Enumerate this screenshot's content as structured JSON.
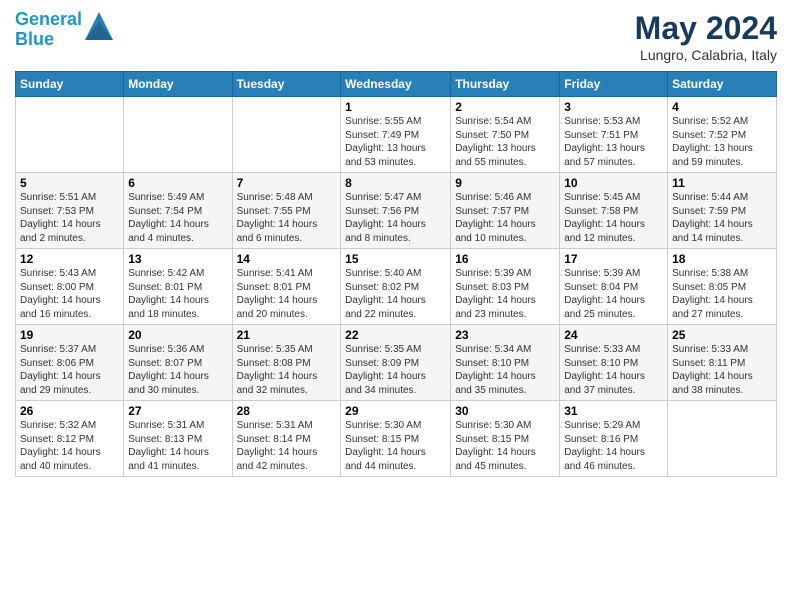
{
  "header": {
    "logo_line1": "General",
    "logo_line2": "Blue",
    "month": "May 2024",
    "location": "Lungro, Calabria, Italy"
  },
  "days_of_week": [
    "Sunday",
    "Monday",
    "Tuesday",
    "Wednesday",
    "Thursday",
    "Friday",
    "Saturday"
  ],
  "weeks": [
    [
      {
        "day": "",
        "info": ""
      },
      {
        "day": "",
        "info": ""
      },
      {
        "day": "",
        "info": ""
      },
      {
        "day": "1",
        "info": "Sunrise: 5:55 AM\nSunset: 7:49 PM\nDaylight: 13 hours\nand 53 minutes."
      },
      {
        "day": "2",
        "info": "Sunrise: 5:54 AM\nSunset: 7:50 PM\nDaylight: 13 hours\nand 55 minutes."
      },
      {
        "day": "3",
        "info": "Sunrise: 5:53 AM\nSunset: 7:51 PM\nDaylight: 13 hours\nand 57 minutes."
      },
      {
        "day": "4",
        "info": "Sunrise: 5:52 AM\nSunset: 7:52 PM\nDaylight: 13 hours\nand 59 minutes."
      }
    ],
    [
      {
        "day": "5",
        "info": "Sunrise: 5:51 AM\nSunset: 7:53 PM\nDaylight: 14 hours\nand 2 minutes."
      },
      {
        "day": "6",
        "info": "Sunrise: 5:49 AM\nSunset: 7:54 PM\nDaylight: 14 hours\nand 4 minutes."
      },
      {
        "day": "7",
        "info": "Sunrise: 5:48 AM\nSunset: 7:55 PM\nDaylight: 14 hours\nand 6 minutes."
      },
      {
        "day": "8",
        "info": "Sunrise: 5:47 AM\nSunset: 7:56 PM\nDaylight: 14 hours\nand 8 minutes."
      },
      {
        "day": "9",
        "info": "Sunrise: 5:46 AM\nSunset: 7:57 PM\nDaylight: 14 hours\nand 10 minutes."
      },
      {
        "day": "10",
        "info": "Sunrise: 5:45 AM\nSunset: 7:58 PM\nDaylight: 14 hours\nand 12 minutes."
      },
      {
        "day": "11",
        "info": "Sunrise: 5:44 AM\nSunset: 7:59 PM\nDaylight: 14 hours\nand 14 minutes."
      }
    ],
    [
      {
        "day": "12",
        "info": "Sunrise: 5:43 AM\nSunset: 8:00 PM\nDaylight: 14 hours\nand 16 minutes."
      },
      {
        "day": "13",
        "info": "Sunrise: 5:42 AM\nSunset: 8:01 PM\nDaylight: 14 hours\nand 18 minutes."
      },
      {
        "day": "14",
        "info": "Sunrise: 5:41 AM\nSunset: 8:01 PM\nDaylight: 14 hours\nand 20 minutes."
      },
      {
        "day": "15",
        "info": "Sunrise: 5:40 AM\nSunset: 8:02 PM\nDaylight: 14 hours\nand 22 minutes."
      },
      {
        "day": "16",
        "info": "Sunrise: 5:39 AM\nSunset: 8:03 PM\nDaylight: 14 hours\nand 23 minutes."
      },
      {
        "day": "17",
        "info": "Sunrise: 5:39 AM\nSunset: 8:04 PM\nDaylight: 14 hours\nand 25 minutes."
      },
      {
        "day": "18",
        "info": "Sunrise: 5:38 AM\nSunset: 8:05 PM\nDaylight: 14 hours\nand 27 minutes."
      }
    ],
    [
      {
        "day": "19",
        "info": "Sunrise: 5:37 AM\nSunset: 8:06 PM\nDaylight: 14 hours\nand 29 minutes."
      },
      {
        "day": "20",
        "info": "Sunrise: 5:36 AM\nSunset: 8:07 PM\nDaylight: 14 hours\nand 30 minutes."
      },
      {
        "day": "21",
        "info": "Sunrise: 5:35 AM\nSunset: 8:08 PM\nDaylight: 14 hours\nand 32 minutes."
      },
      {
        "day": "22",
        "info": "Sunrise: 5:35 AM\nSunset: 8:09 PM\nDaylight: 14 hours\nand 34 minutes."
      },
      {
        "day": "23",
        "info": "Sunrise: 5:34 AM\nSunset: 8:10 PM\nDaylight: 14 hours\nand 35 minutes."
      },
      {
        "day": "24",
        "info": "Sunrise: 5:33 AM\nSunset: 8:10 PM\nDaylight: 14 hours\nand 37 minutes."
      },
      {
        "day": "25",
        "info": "Sunrise: 5:33 AM\nSunset: 8:11 PM\nDaylight: 14 hours\nand 38 minutes."
      }
    ],
    [
      {
        "day": "26",
        "info": "Sunrise: 5:32 AM\nSunset: 8:12 PM\nDaylight: 14 hours\nand 40 minutes."
      },
      {
        "day": "27",
        "info": "Sunrise: 5:31 AM\nSunset: 8:13 PM\nDaylight: 14 hours\nand 41 minutes."
      },
      {
        "day": "28",
        "info": "Sunrise: 5:31 AM\nSunset: 8:14 PM\nDaylight: 14 hours\nand 42 minutes."
      },
      {
        "day": "29",
        "info": "Sunrise: 5:30 AM\nSunset: 8:15 PM\nDaylight: 14 hours\nand 44 minutes."
      },
      {
        "day": "30",
        "info": "Sunrise: 5:30 AM\nSunset: 8:15 PM\nDaylight: 14 hours\nand 45 minutes."
      },
      {
        "day": "31",
        "info": "Sunrise: 5:29 AM\nSunset: 8:16 PM\nDaylight: 14 hours\nand 46 minutes."
      },
      {
        "day": "",
        "info": ""
      }
    ]
  ]
}
